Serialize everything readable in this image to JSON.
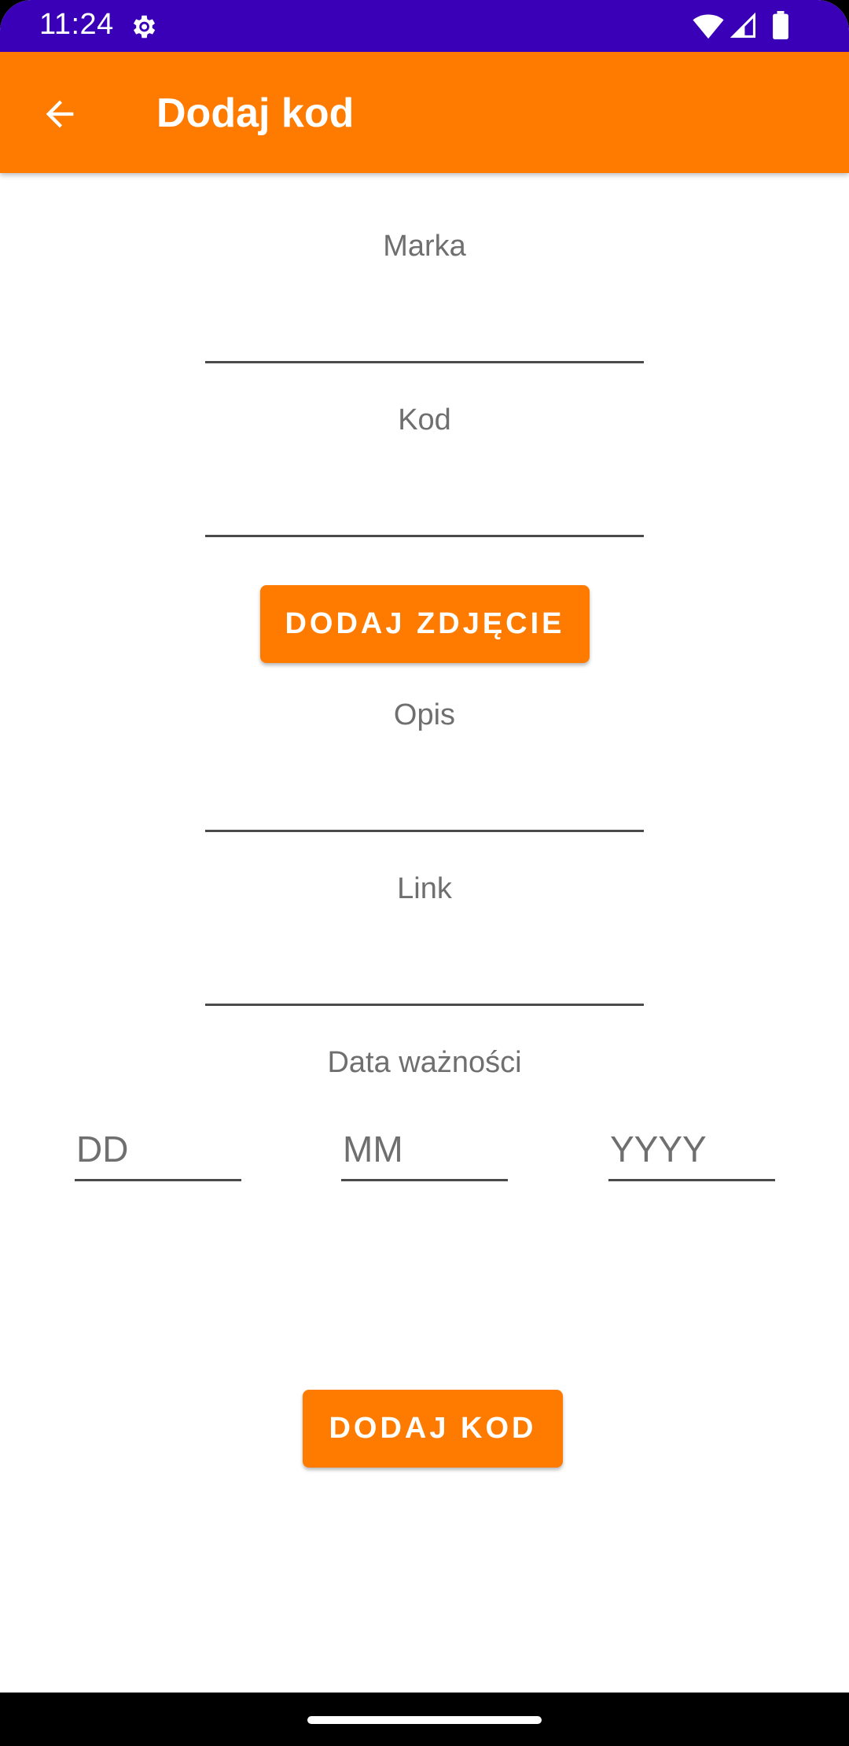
{
  "status_bar": {
    "time": "11:24",
    "icons": [
      "settings-gear-icon",
      "wifi-icon",
      "cell-signal-icon",
      "battery-icon"
    ],
    "background": "#3a00b8"
  },
  "app_bar": {
    "title": "Dodaj kod",
    "back_icon": "arrow-back-icon",
    "background": "#ff7b00"
  },
  "form": {
    "brand": {
      "label": "Marka",
      "value": ""
    },
    "code": {
      "label": "Kod",
      "value": ""
    },
    "add_photo_button": "DODAJ ZDJĘCIE",
    "description": {
      "label": "Opis",
      "value": ""
    },
    "link": {
      "label": "Link",
      "value": ""
    },
    "expiry": {
      "label": "Data ważności",
      "day_placeholder": "DD",
      "month_placeholder": "MM",
      "year_placeholder": "YYYY"
    },
    "submit_button": "DODAJ KOD"
  },
  "colors": {
    "accent": "#ff7b00",
    "label_text": "#6f6f6f"
  }
}
